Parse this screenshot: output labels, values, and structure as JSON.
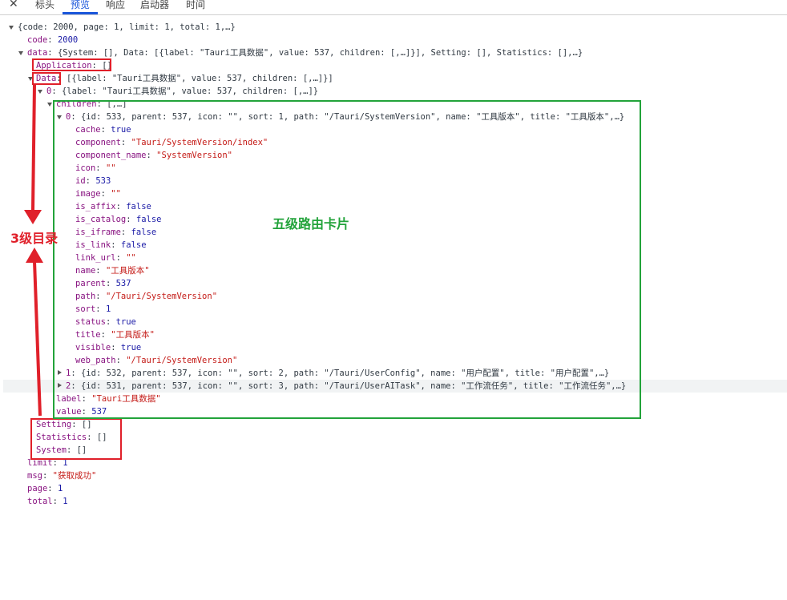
{
  "tabs": {
    "close": "✕",
    "items": [
      "标头",
      "预览",
      "响应",
      "启动器",
      "时间"
    ],
    "active_index": 1
  },
  "tree": {
    "root": "{code: 2000, page: 1, limit: 1, total: 1,…}",
    "code": {
      "key": "code",
      "value": "2000"
    },
    "data": {
      "key": "data",
      "summary": "{System: [], Data: [{label: \"Tauri工具数据\", value: 537, children: [,…]}], Setting: [], Statistics: [],…}"
    },
    "application": {
      "key": "Application",
      "value": "[]"
    },
    "data_arr": {
      "key": "Data",
      "summary": "[{label: \"Tauri工具数据\", value: 537, children: [,…]}]"
    },
    "item0": {
      "key": "0",
      "summary": "{label: \"Tauri工具数据\", value: 537, children: [,…]}"
    },
    "children": {
      "key": "children",
      "summary": "[,…]"
    },
    "child0": {
      "key": "0",
      "summary": "{id: 533, parent: 537, icon: \"\", sort: 1, path: \"/Tauri/SystemVersion\", name: \"工具版本\", title: \"工具版本\",…}",
      "props": [
        {
          "key": "cache",
          "value": "true",
          "type": "b"
        },
        {
          "key": "component",
          "value": "\"Tauri/SystemVersion/index\"",
          "type": "s"
        },
        {
          "key": "component_name",
          "value": "\"SystemVersion\"",
          "type": "s"
        },
        {
          "key": "icon",
          "value": "\"\"",
          "type": "s"
        },
        {
          "key": "id",
          "value": "533",
          "type": "n"
        },
        {
          "key": "image",
          "value": "\"\"",
          "type": "s"
        },
        {
          "key": "is_affix",
          "value": "false",
          "type": "b"
        },
        {
          "key": "is_catalog",
          "value": "false",
          "type": "b"
        },
        {
          "key": "is_iframe",
          "value": "false",
          "type": "b"
        },
        {
          "key": "is_link",
          "value": "false",
          "type": "b"
        },
        {
          "key": "link_url",
          "value": "\"\"",
          "type": "s"
        },
        {
          "key": "name",
          "value": "\"工具版本\"",
          "type": "s"
        },
        {
          "key": "parent",
          "value": "537",
          "type": "n"
        },
        {
          "key": "path",
          "value": "\"/Tauri/SystemVersion\"",
          "type": "s"
        },
        {
          "key": "sort",
          "value": "1",
          "type": "n"
        },
        {
          "key": "status",
          "value": "true",
          "type": "b"
        },
        {
          "key": "title",
          "value": "\"工具版本\"",
          "type": "s"
        },
        {
          "key": "visible",
          "value": "true",
          "type": "b"
        },
        {
          "key": "web_path",
          "value": "\"/Tauri/SystemVersion\"",
          "type": "s"
        }
      ]
    },
    "child1": {
      "key": "1",
      "summary": "{id: 532, parent: 537, icon: \"\", sort: 2, path: \"/Tauri/UserConfig\", name: \"用户配置\", title: \"用户配置\",…}"
    },
    "child2": {
      "key": "2",
      "summary": "{id: 531, parent: 537, icon: \"\", sort: 3, path: \"/Tauri/UserAITask\", name: \"工作流任务\", title: \"工作流任务\",…}"
    },
    "label": {
      "key": "label",
      "value": "\"Tauri工具数据\""
    },
    "value": {
      "key": "value",
      "value": "537"
    },
    "setting": {
      "key": "Setting",
      "value": "[]"
    },
    "statistics": {
      "key": "Statistics",
      "value": "[]"
    },
    "system": {
      "key": "System",
      "value": "[]"
    },
    "limit": {
      "key": "limit",
      "value": "1"
    },
    "msg": {
      "key": "msg",
      "value": "\"获取成功\""
    },
    "page": {
      "key": "page",
      "value": "1"
    },
    "total": {
      "key": "total",
      "value": "1"
    }
  },
  "annotations": {
    "left_label": "3级目录",
    "center_label": "五级路由卡片",
    "red_color": "#e0202a",
    "green_color": "#22a33a"
  }
}
